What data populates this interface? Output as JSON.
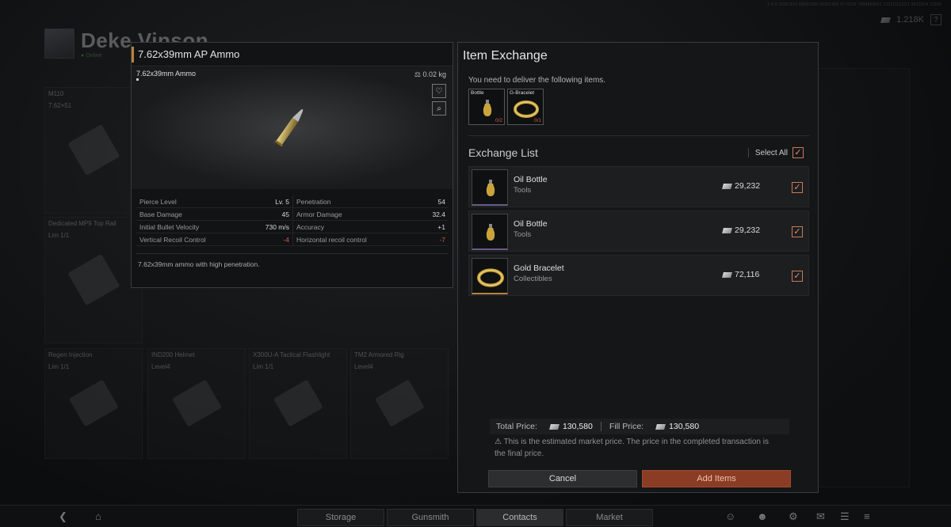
{
  "meta": {
    "build": "1.0.0.11051110 08001205 00201205 07 0120 7998809021 211111111111 0612024 11509"
  },
  "topbar": {
    "currency": "1.218K",
    "help": "?"
  },
  "player": {
    "name": "Deke Vinson",
    "status": "● Online"
  },
  "background_slots": [
    {
      "name": "M110",
      "sub": "7.62×51"
    },
    {
      "name": "Dedicated MP9 Top Rail",
      "sub": "Lim 1/1"
    },
    {
      "name": "Regen Injection",
      "sub": "Lim 1/1"
    },
    {
      "name": "IND200 Helmet",
      "sub": "Level4"
    },
    {
      "name": "X300U-A Tactical Flashlight",
      "sub": "Lim 1/1"
    },
    {
      "name": "TM2 Armored Rig",
      "sub": "Level4"
    }
  ],
  "bottom_nav": {
    "tabs": [
      "Storage",
      "Gunsmith",
      "Contacts",
      "Market"
    ],
    "active": "Contacts"
  },
  "item": {
    "title": "7.62x39mm AP Ammo",
    "view_name": "7.62x39mm Ammo",
    "weight": "0.02 kg",
    "stats": [
      {
        "l_label": "Pierce Level",
        "l_val": "Lv. 5",
        "r_label": "Penetration",
        "r_val": "54"
      },
      {
        "l_label": "Base Damage",
        "l_val": "45",
        "r_label": "Armor Damage",
        "r_val": "32.4"
      },
      {
        "l_label": "Initial Bullet Velocity",
        "l_val": "730 m/s",
        "r_label": "Accuracy",
        "r_val": "+1"
      },
      {
        "l_label": "Vertical Recoil Control",
        "l_val": "-4",
        "r_label": "Horizontal recoil control",
        "r_val": "-7"
      }
    ],
    "description": "7.62x39mm ammo with high penetration."
  },
  "exchange": {
    "title": "Item Exchange",
    "subtitle": "You need to deliver the following items.",
    "required": [
      {
        "name": "Bottle",
        "count": "0/2"
      },
      {
        "name": "G-Bracelet",
        "count": "0/1"
      }
    ],
    "list_title": "Exchange List",
    "select_all": "Select All",
    "rows": [
      {
        "name": "Oil Bottle",
        "category": "Tools",
        "price": "29,232"
      },
      {
        "name": "Oil Bottle",
        "category": "Tools",
        "price": "29,232"
      },
      {
        "name": "Gold Bracelet",
        "category": "Collectibles",
        "price": "72,116"
      }
    ],
    "total_label": "Total Price:",
    "total_value": "130,580",
    "fill_label": "Fill Price:",
    "fill_value": "130,580",
    "notice": "This is the estimated market price. The price in the completed transaction is the final price.",
    "cancel": "Cancel",
    "add": "Add Items"
  },
  "colors": {
    "accent": "#b8843c",
    "danger": "#d9584a",
    "add_button": "#8a3c25"
  }
}
